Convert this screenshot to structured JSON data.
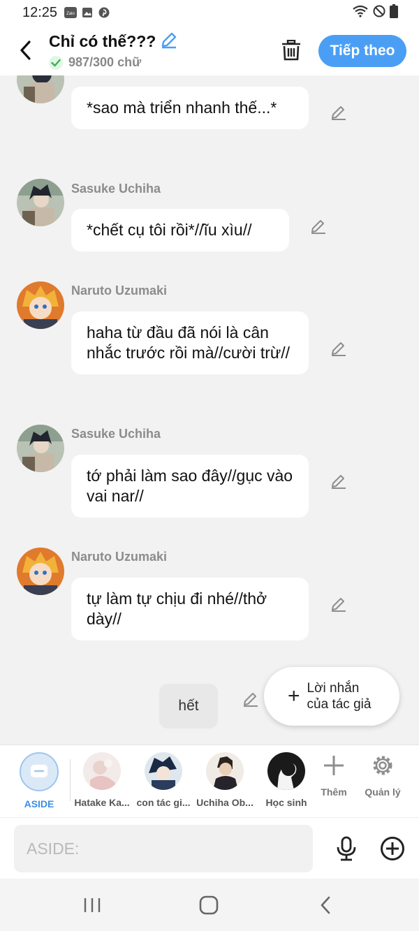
{
  "status_bar": {
    "time": "12:25",
    "app_badge": "Zalo"
  },
  "header": {
    "title": "Chỉ có thế???",
    "word_count": "987/300 chữ",
    "next_label": "Tiếp theo"
  },
  "messages": [
    {
      "speaker": "",
      "text": "*sao mà triển nhanh thế...*",
      "avatar": "sasuke-avatar"
    },
    {
      "speaker": "Sasuke Uchiha",
      "text": "*chết cụ tôi rồi*//ĩu xìu//",
      "avatar": "sasuke-avatar"
    },
    {
      "speaker": "Naruto Uzumaki",
      "text": "haha từ đầu đã nói là cân nhắc trước rồi mà//cười trừ//",
      "avatar": "naruto-avatar"
    },
    {
      "speaker": "Sasuke Uchiha",
      "text": "tớ phải làm sao đây//gục vào vai nar//",
      "avatar": "sasuke-avatar"
    },
    {
      "speaker": "Naruto Uzumaki",
      "text": "tự làm tự chịu đi nhé//thở dày//",
      "avatar": "naruto-avatar"
    }
  ],
  "aside_message": "hết",
  "author_note_button": "Lời nhắn của tác giả",
  "characters": [
    {
      "label": "ASIDE"
    },
    {
      "label": "Hatake Ka..."
    },
    {
      "label": "con tác gi..."
    },
    {
      "label": "Uchiha Ob..."
    },
    {
      "label": "Học sinh"
    }
  ],
  "tools": {
    "add_label": "Thêm",
    "manage_label": "Quản lý"
  },
  "composer": {
    "placeholder": "ASIDE:"
  },
  "colors": {
    "accent": "#4a9ff5",
    "background": "#f2f2f2",
    "bubble": "#ffffff"
  }
}
